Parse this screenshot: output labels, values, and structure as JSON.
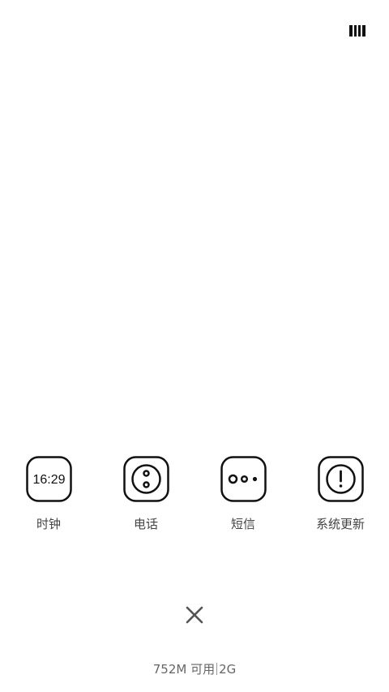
{
  "toolbar": {
    "layout_icon": "grid-layout-icon"
  },
  "apps": [
    {
      "label": "时钟",
      "icon": "clock-icon",
      "time": "16:29"
    },
    {
      "label": "电话",
      "icon": "phone-icon"
    },
    {
      "label": "短信",
      "icon": "message-icon"
    },
    {
      "label": "系统更新",
      "icon": "system-update-icon"
    }
  ],
  "close": {
    "icon": "close-icon"
  },
  "status": {
    "memory_available": "752M 可用",
    "memory_total": "2G"
  },
  "colors": {
    "background": "#ffffff",
    "icon_stroke": "#111111",
    "label_text": "#444444",
    "status_text": "#666666"
  }
}
